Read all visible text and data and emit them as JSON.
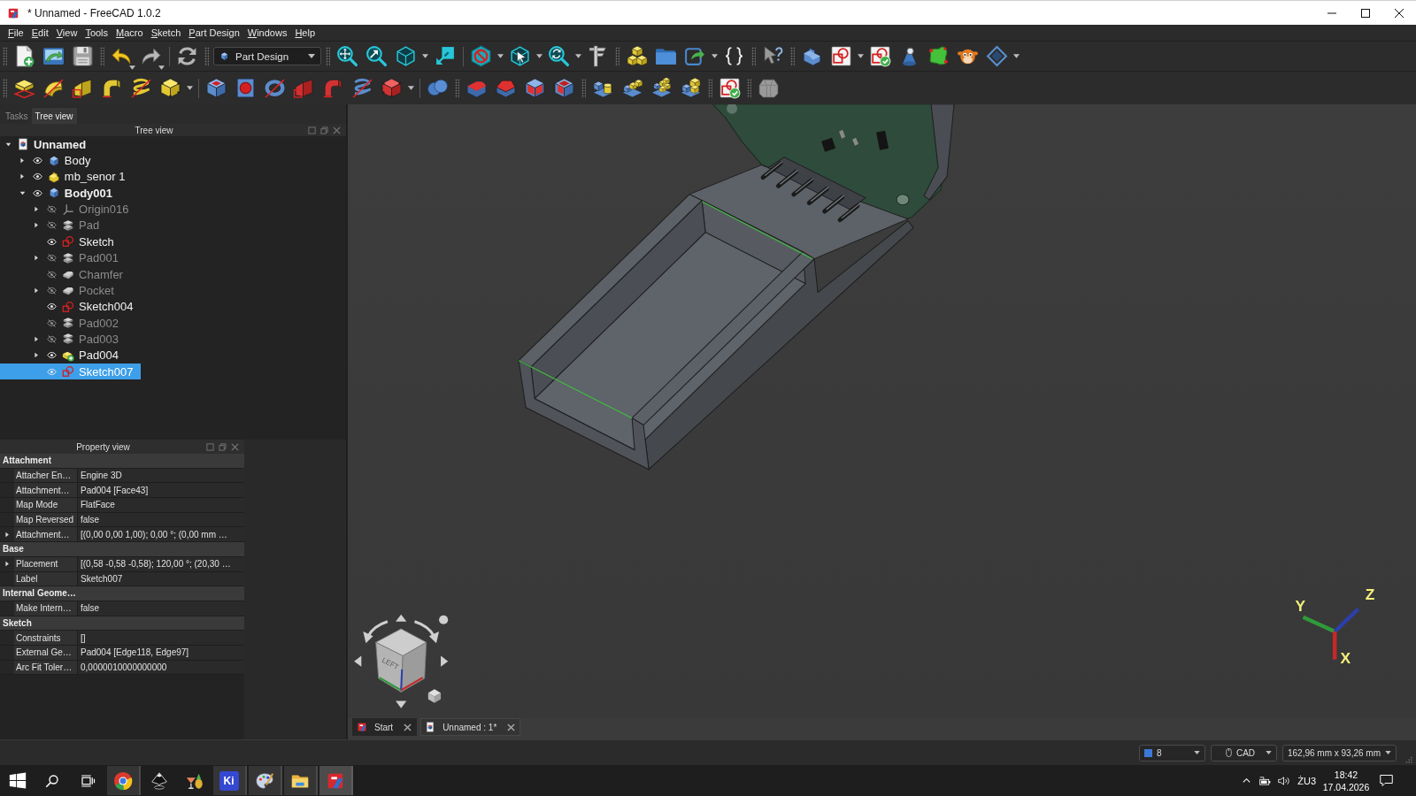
{
  "window": {
    "title": "* Unnamed - FreeCAD 1.0.2"
  },
  "menu": [
    "File",
    "Edit",
    "View",
    "Tools",
    "Macro",
    "Sketch",
    "Part Design",
    "Windows",
    "Help"
  ],
  "workbench_selector": {
    "value": "Part Design"
  },
  "dock_tabs": [
    {
      "label": "Tasks",
      "selected": false
    },
    {
      "label": "Tree view",
      "selected": true
    }
  ],
  "tree_view": {
    "title": "Tree view",
    "items": [
      {
        "label": "Unnamed",
        "kind": "document",
        "expanded": true,
        "visible": true,
        "active": true,
        "selected": false,
        "children": [
          {
            "label": "Body",
            "kind": "body",
            "expanded": false,
            "visible": true,
            "active": false,
            "selected": false
          },
          {
            "label": "mb_senor 1",
            "kind": "part",
            "expanded": false,
            "visible": true,
            "active": false,
            "selected": false
          },
          {
            "label": "Body001",
            "kind": "body",
            "expanded": true,
            "visible": true,
            "active": true,
            "selected": false,
            "children": [
              {
                "label": "Origin016",
                "kind": "origin",
                "expanded": false,
                "visible": false,
                "active": false,
                "selected": false
              },
              {
                "label": "Pad",
                "kind": "pad",
                "expanded": false,
                "visible": false,
                "active": false,
                "selected": false
              },
              {
                "label": "Sketch",
                "kind": "sketch",
                "visible": true,
                "active": false,
                "selected": false
              },
              {
                "label": "Pad001",
                "kind": "pad",
                "expanded": false,
                "visible": false,
                "active": false,
                "selected": false
              },
              {
                "label": "Chamfer",
                "kind": "dressup",
                "visible": false,
                "active": false,
                "selected": false
              },
              {
                "label": "Pocket",
                "kind": "dressup",
                "expanded": false,
                "visible": false,
                "active": false,
                "selected": false
              },
              {
                "label": "Sketch004",
                "kind": "sketch",
                "visible": true,
                "active": false,
                "selected": false
              },
              {
                "label": "Pad002",
                "kind": "pad",
                "visible": false,
                "active": false,
                "selected": false
              },
              {
                "label": "Pad003",
                "kind": "pad",
                "expanded": false,
                "visible": false,
                "active": false,
                "selected": false
              },
              {
                "label": "Pad004",
                "kind": "tip",
                "expanded": false,
                "visible": true,
                "active": false,
                "selected": false
              },
              {
                "label": "Sketch007",
                "kind": "sketch",
                "visible": true,
                "active": false,
                "selected": true
              }
            ]
          }
        ]
      }
    ]
  },
  "property_view": {
    "title": "Property view",
    "groups": [
      {
        "name": "Attachment",
        "properties": [
          {
            "name": "Attacher En…",
            "value": "Engine 3D"
          },
          {
            "name": "Attachment…",
            "value": "Pad004 [Face43]"
          },
          {
            "name": "Map Mode",
            "value": "FlatFace"
          },
          {
            "name": "Map Reversed",
            "value": "false"
          },
          {
            "name": "Attachment…",
            "value": "[(0,00 0,00 1,00); 0,00 °; (0,00 mm …",
            "expanded": false
          }
        ]
      },
      {
        "name": "Base",
        "properties": [
          {
            "name": "Placement",
            "value": "[(0,58 -0,58 -0,58); 120,00 °; (20,30 …",
            "expanded": false
          },
          {
            "name": "Label",
            "value": "Sketch007"
          }
        ]
      },
      {
        "name": "Internal Geome…",
        "properties": [
          {
            "name": "Make Intern…",
            "value": "false"
          }
        ]
      },
      {
        "name": "Sketch",
        "properties": [
          {
            "name": "Constraints",
            "value": "[]"
          },
          {
            "name": "External Ge…",
            "value": "Pad004 [Edge118, Edge97]"
          },
          {
            "name": "Arc Fit Toler…",
            "value": "0,0000010000000000"
          }
        ]
      }
    ]
  },
  "view3d": {
    "axes": [
      {
        "kind": "y",
        "label": "Y",
        "color": "#2f9a3a"
      },
      {
        "kind": "z",
        "label": "Z",
        "color": "#2c3fa8"
      },
      {
        "kind": "x",
        "label": "X",
        "color": "#c62828"
      }
    ],
    "nav_cube": {
      "face_label": "LEFT"
    }
  },
  "document_tabs": [
    {
      "label": "Start",
      "kind": "start",
      "selected": false
    },
    {
      "label": "Unnamed : 1*",
      "kind": "document",
      "selected": true
    }
  ],
  "status_bar": {
    "dropdowns": [
      {
        "kind": "swatch",
        "value": "8"
      },
      {
        "kind": "mouse",
        "value": "CAD"
      },
      {
        "kind": "plain",
        "value": "162,96 mm x 93,26 mm"
      }
    ]
  },
  "taskbar": {
    "apps": [
      {
        "kind": "ring",
        "running": true,
        "selected": false
      },
      {
        "kind": "drop",
        "running": false,
        "selected": false
      },
      {
        "kind": "drink",
        "running": false,
        "selected": false
      },
      {
        "kind": "tile",
        "label": "Ki",
        "running": true,
        "selected": false
      },
      {
        "kind": "palette",
        "running": true,
        "selected": false
      },
      {
        "kind": "folder",
        "running": true,
        "selected": false
      },
      {
        "kind": "app",
        "running": true,
        "selected": true
      }
    ],
    "tray": {
      "language": "ŻU3",
      "time": "18:42",
      "date": "17.04.2026"
    }
  }
}
